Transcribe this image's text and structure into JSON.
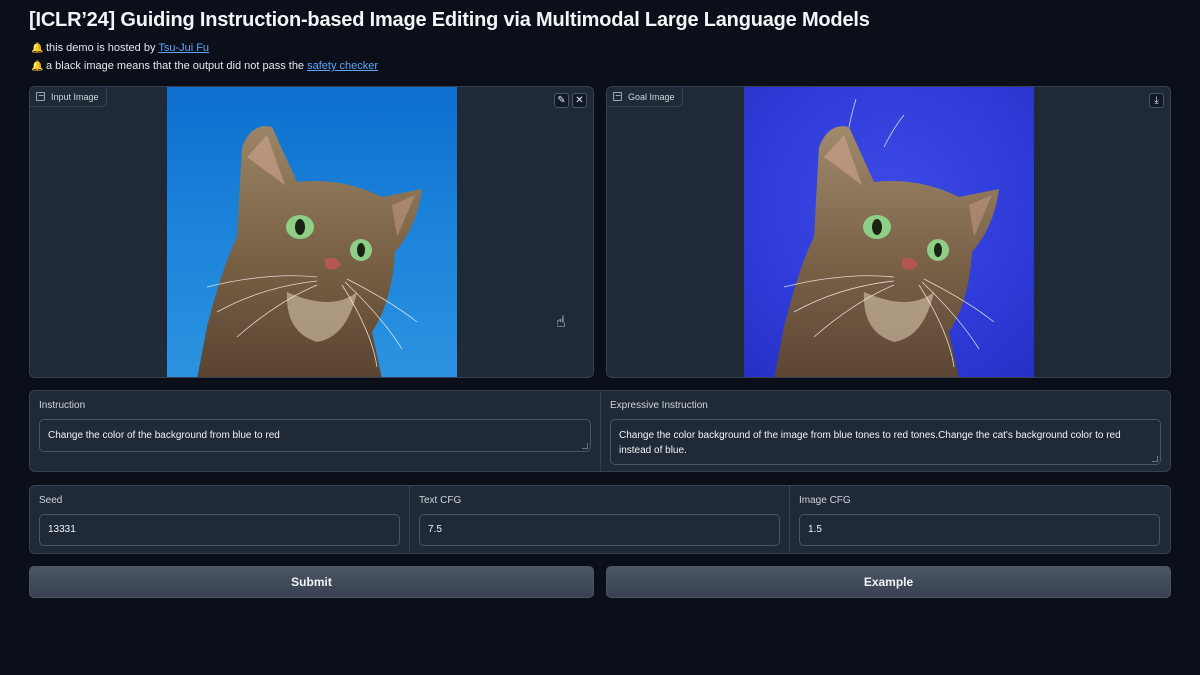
{
  "header": {
    "title": "[ICLR’24] Guiding Instruction-based Image Editing via Multimodal Large Language Models",
    "note1_prefix": "this demo is hosted by ",
    "note1_link": "Tsu-Jui Fu",
    "note2_prefix": "a black image means that the output did not pass the ",
    "note2_link": "safety checker",
    "note_icon": "bell-icon"
  },
  "input_image": {
    "label": "Input Image",
    "edit_icon": "pencil-icon",
    "clear_icon": "close-icon"
  },
  "goal_image": {
    "label": "Goal Image",
    "download_icon": "download-icon"
  },
  "instruction": {
    "label": "Instruction",
    "value": "Change the color of the background from blue to red"
  },
  "expressive_instruction": {
    "label": "Expressive Instruction",
    "value": "Change the color background of the image from blue tones to red tones.Change the cat's background color to red instead of blue."
  },
  "params": {
    "seed_label": "Seed",
    "seed_value": "13331",
    "text_cfg_label": "Text CFG",
    "text_cfg_value": "7.5",
    "image_cfg_label": "Image CFG",
    "image_cfg_value": "1.5"
  },
  "buttons": {
    "submit": "Submit",
    "example": "Example"
  },
  "colors": {
    "background": "#0b0f19",
    "panel": "#1f2937",
    "border": "#374151",
    "link": "#60a5fa",
    "input_sky": "#1e86db",
    "goal_bg": "#2f3bd8"
  }
}
